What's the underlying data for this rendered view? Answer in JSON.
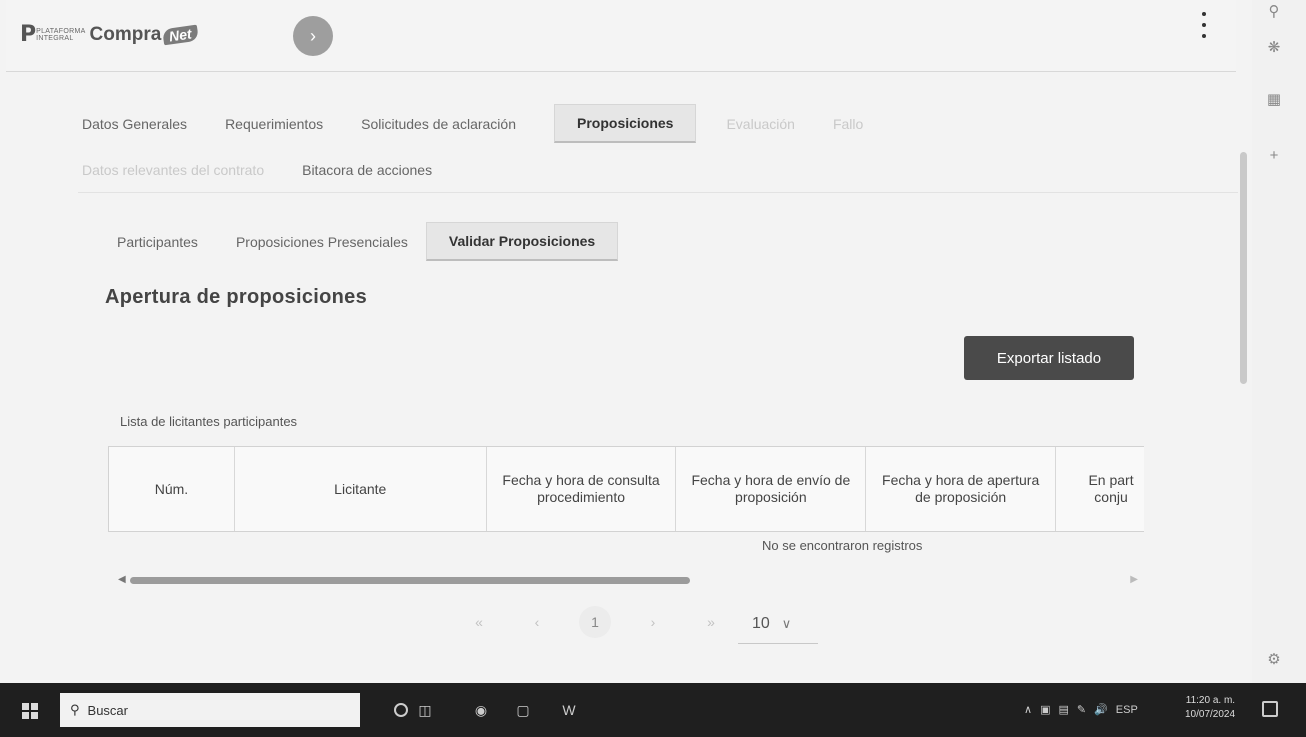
{
  "header": {
    "logo_mark": "P",
    "logo_small_1": "PLATAFORMA",
    "logo_small_2": "INTEGRAL",
    "logo_main": "Compra",
    "logo_net": "Net",
    "expand_symbol": "›"
  },
  "main_tabs": [
    {
      "label": "Datos Generales",
      "state": "normal"
    },
    {
      "label": "Requerimientos",
      "state": "normal"
    },
    {
      "label": "Solicitudes de aclaración",
      "state": "normal"
    },
    {
      "label": "Proposiciones",
      "state": "active"
    },
    {
      "label": "Evaluación",
      "state": "disabled"
    },
    {
      "label": "Fallo",
      "state": "disabled"
    }
  ],
  "main_tabs_row2": [
    {
      "label": "Datos relevantes del contrato",
      "state": "disabled"
    },
    {
      "label": "Bitacora de acciones",
      "state": "normal"
    }
  ],
  "sub_tabs": [
    {
      "label": "Participantes",
      "state": "normal"
    },
    {
      "label": "Proposiciones Presenciales",
      "state": "normal"
    },
    {
      "label": "Validar Proposiciones",
      "state": "active"
    }
  ],
  "section": {
    "title": "Apertura de proposiciones",
    "export_button": "Exportar listado",
    "list_label": "Lista de licitantes participantes",
    "empty_message": "No se encontraron registros"
  },
  "table": {
    "columns": [
      "Núm.",
      "Licitante",
      "Fecha y hora de consulta procedimiento",
      "Fecha y hora de envío de proposición",
      "Fecha y hora de apertura de proposición",
      "En part conju"
    ]
  },
  "pagination": {
    "first": "«",
    "prev": "‹",
    "current": "1",
    "next": "›",
    "last": "»",
    "page_size": "10",
    "page_size_icon": "chevron-down-icon"
  },
  "taskbar": {
    "search_placeholder": "Buscar",
    "language": "ESP",
    "time": "11:20 a. m.",
    "date": "10/07/2024"
  },
  "colors": {
    "primary_button": "#4a4a4a",
    "active_tab_bg": "#e6e6e6",
    "taskbar": "#1f1f1f"
  }
}
